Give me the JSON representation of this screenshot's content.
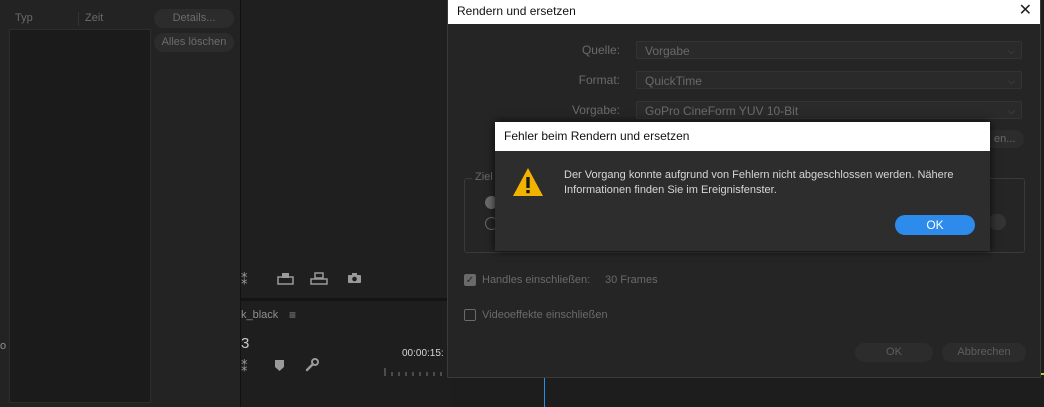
{
  "events_panel": {
    "col_type": "Typ",
    "col_time": "Zeit",
    "details_button": "Details...",
    "clear_all_button": "Alles löschen"
  },
  "background": {
    "sequence_name": "k_black",
    "partial_timecode": "3",
    "timecode": "00:00:15:",
    "edge_char": "o"
  },
  "dialog": {
    "title": "Rendern und ersetzen",
    "source_label": "Quelle:",
    "source_value": "Vorgabe",
    "format_label": "Format:",
    "format_value": "QuickTime",
    "preset_label": "Vorgabe:",
    "preset_value": "GoPro CineForm YUV 10-Bit",
    "mid_button": "en...",
    "target_label": "Ziel",
    "handles_label": "Handles einschließen:",
    "handles_value": "30 Frames",
    "handles_checked": true,
    "effects_label": "Videoeffekte einschließen",
    "effects_checked": false,
    "ok_button": "OK",
    "cancel_button": "Abbrechen"
  },
  "error": {
    "title": "Fehler beim Rendern und ersetzen",
    "message_line1": "Der Vorgang konnte aufgrund von Fehlern nicht abgeschlossen werden. Nähere",
    "message_line2": "Informationen finden Sie im Ereignisfenster.",
    "ok_button": "OK",
    "accent": "#2d8ceb",
    "warning_color": "#f0b400"
  }
}
